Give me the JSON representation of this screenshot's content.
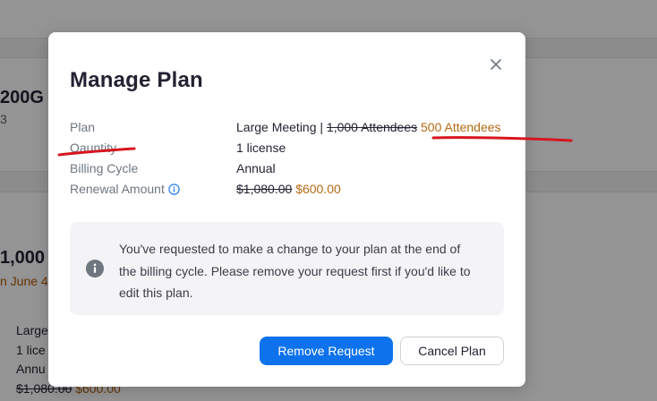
{
  "background": {
    "storage_title": "200G",
    "storage_sub": "3",
    "attendees_title": "1,000",
    "renew_text": "n June 4",
    "lines": [
      {
        "text": "Large"
      },
      {
        "text": "1 lice"
      },
      {
        "text": "Annu"
      },
      {
        "strike": "$1,080.00",
        "price": "$600.00"
      }
    ]
  },
  "modal": {
    "title": "Manage Plan",
    "close_icon": "close-icon",
    "details": {
      "plan": {
        "label": "Plan",
        "prefix": "Large Meeting | ",
        "old": "1,000 Attendees",
        "new": "500 Attendees"
      },
      "quantity": {
        "label": "Qauntity",
        "value": "1 license"
      },
      "billing_cycle": {
        "label": "Billing Cycle",
        "value": "Annual"
      },
      "renewal_amount": {
        "label": "Renewal Amount",
        "old": "$1,080.00",
        "new": "$600.00",
        "info_icon": "info-icon"
      }
    },
    "notice": {
      "icon": "info-circle-icon",
      "text": "You've requested to make a change to your plan at the end of the billing cycle. Please remove your request first if you'd like to edit this plan."
    },
    "buttons": {
      "remove_request": "Remove Request",
      "cancel_plan": "Cancel Plan"
    }
  },
  "colors": {
    "primary": "#0e72ed",
    "accent_orange": "#b56a12",
    "annotation_red": "#d7161e"
  }
}
